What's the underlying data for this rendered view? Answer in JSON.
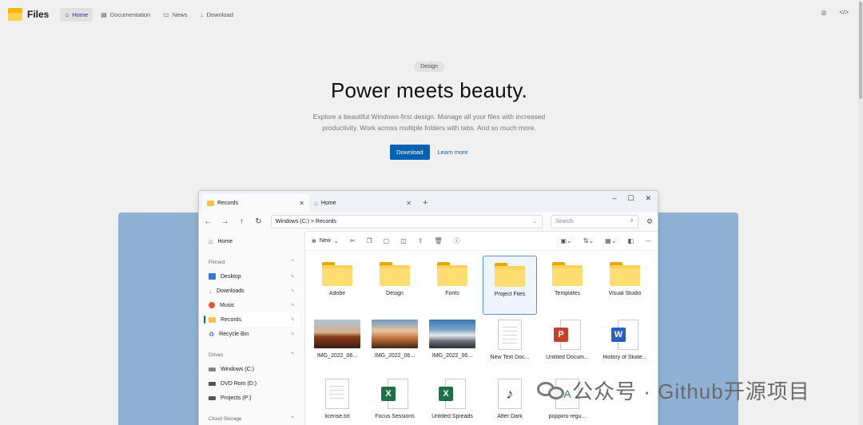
{
  "brand": {
    "name": "Files"
  },
  "nav": [
    {
      "label": "Home",
      "icon": "home-icon"
    },
    {
      "label": "Documentation",
      "icon": "book-icon"
    },
    {
      "label": "News",
      "icon": "news-icon"
    },
    {
      "label": "Download",
      "icon": "download-icon"
    }
  ],
  "hero": {
    "badge": "Design",
    "title": "Power meets beauty.",
    "subtitle": "Explore a beautiful Windows-first design. Manage all your files with increased productivity. Work across multiple folders with tabs. And so much more.",
    "primary": "Download",
    "secondary": "Learn more"
  },
  "app": {
    "tabs": [
      {
        "label": "Records"
      },
      {
        "label": "Home"
      }
    ],
    "path": "Windows (C:) > Records",
    "search_placeholder": "Search",
    "toolbar": {
      "new_label": "New"
    },
    "sidebar": {
      "home": "Home",
      "pinned_header": "Pinned",
      "pinned": [
        "Desktop",
        "Downloads",
        "Music",
        "Records",
        "Recycle Bin"
      ],
      "drives_header": "Drives",
      "drives": [
        "Windows (C:)",
        "DVD Rom (D:)",
        "Projects (P:)"
      ],
      "cloud_header": "Cloud Storage"
    },
    "files": [
      "Adobe",
      "Design",
      "Fonts",
      "Project Files",
      "Templates",
      "Visual Studio",
      "IMG_2022_06...",
      "IMG_2022_06...",
      "IMG_2022_06...",
      "New Text Doc...",
      "Untitled Docum...",
      "History of Skate...",
      "license.txt",
      "Focus Sessions",
      "Untitled Spreads",
      "After Dark",
      "poppins-regu..."
    ]
  },
  "watermark": {
    "text": "公众号 · Github开源项目"
  }
}
